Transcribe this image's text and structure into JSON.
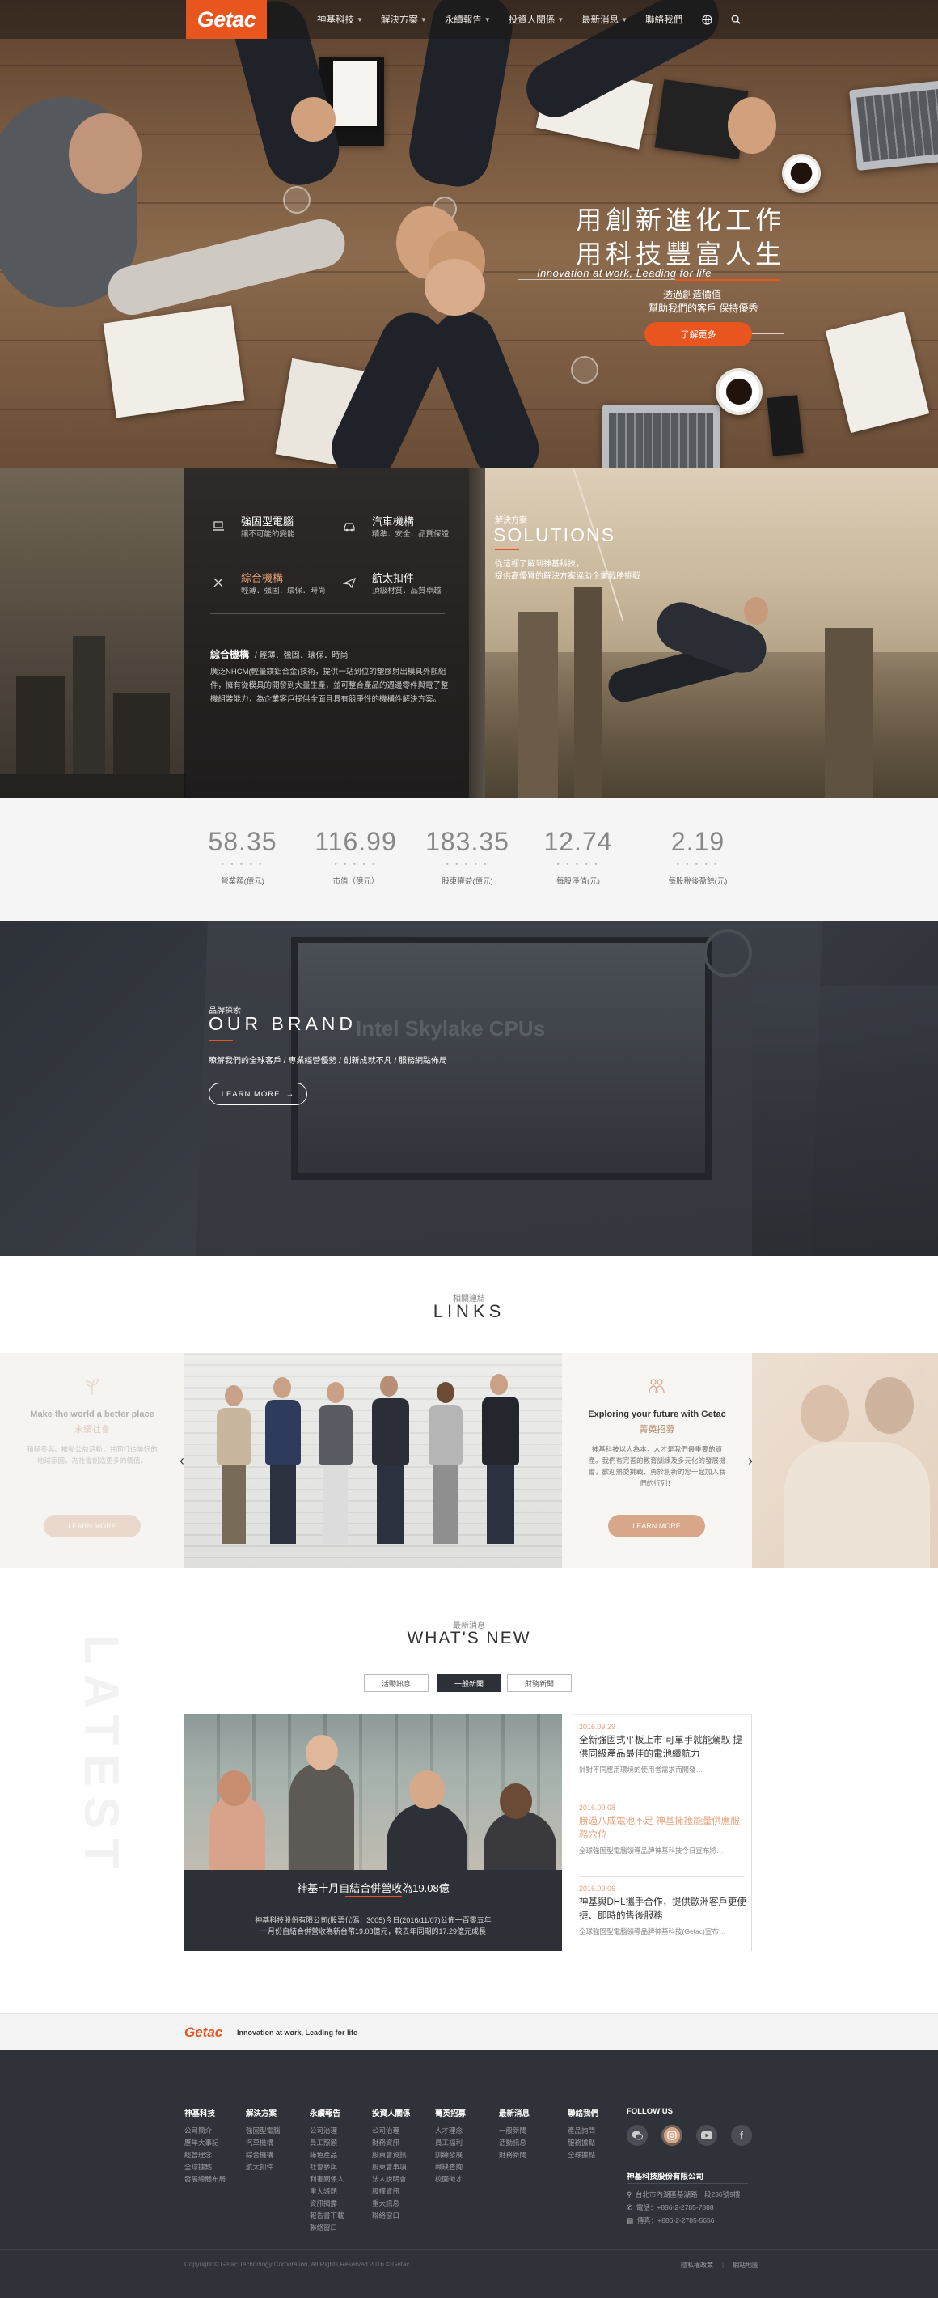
{
  "header": {
    "logo": "Getac",
    "nav": [
      {
        "label": "神基科技"
      },
      {
        "label": "解決方案"
      },
      {
        "label": "永續報告"
      },
      {
        "label": "投資人關係"
      },
      {
        "label": "最新消息"
      },
      {
        "label": "聯絡我們"
      }
    ]
  },
  "hero": {
    "title_line1": "用創新進化工作",
    "title_line2": "用科技豐富人生",
    "subtitle": "Innovation at work, Leading for life",
    "tag_line1": "透過創造價值",
    "tag_line2": "幫助我們的客戶 保持優秀",
    "button": "了解更多"
  },
  "solutions": {
    "items": [
      {
        "title": "強固型電腦",
        "sub": "讓不可能的變能",
        "icon": "laptop-icon"
      },
      {
        "title": "汽車機構",
        "sub": "精準．安全．品質保證",
        "icon": "car-icon"
      },
      {
        "title": "綜合機構",
        "sub": "輕薄．強固．環保．時尚",
        "icon": "tools-icon"
      },
      {
        "title": "航太扣件",
        "sub": "頂級材質．品質卓越",
        "icon": "plane-icon"
      }
    ],
    "desc_title": "綜合機構",
    "desc_sub": "/ 輕薄．強固．環保．時尚",
    "desc_body": "廣泛NHCM(輕量鎂鋁合金)技術，提供一站到位的塑膠射出模具外觀組件，擁有從模具的開發到大量生產，並可整合產品的週邊零件與電子整機組裝能力，為企業客戶提供全面且具有競爭性的機構件解決方案。",
    "small": "解決方案",
    "big": "SOLUTIONS",
    "intro1": "從這裡了解到神基科技，",
    "intro2": "提供高優質的解決方案協助企業戰勝挑戰"
  },
  "stats": [
    {
      "value": "58.35",
      "label": "營業額(億元)"
    },
    {
      "value": "116.99",
      "label": "市值（億元）"
    },
    {
      "value": "183.35",
      "label": "股東權益(億元)"
    },
    {
      "value": "12.74",
      "label": "每股淨值(元)"
    },
    {
      "value": "2.19",
      "label": "每股稅後盈餘(元)"
    }
  ],
  "brand": {
    "small": "品牌探索",
    "title": "OUR BRAND",
    "desc": "瞭解我們的全球客戶 / 專業經營優勢 / 創新成就不凡 / 服務網點佈局",
    "button": "LEARN MORE",
    "screen_text": "Intel Skylake CPUs"
  },
  "links": {
    "small": "相關連結",
    "title": "LINKS",
    "card_left": {
      "title": "Make the world a better place",
      "sub": "永續社會",
      "body": "積極參與、推動公益活動，共同打造美好的地球家園，為社會創造更多的價值。",
      "button": "LEARN MORE"
    },
    "card_right": {
      "title": "Exploring your future with Getac",
      "sub": "菁英招募",
      "body": "神基科技以人為本，人才是我們最重要的資產。我們有完善的教育訓練及多元化的發展機會，歡迎熱愛挑戰、勇於創新的您一起加入我們的行列！",
      "button": "LEARN MORE"
    }
  },
  "whats_new": {
    "small": "最新消息",
    "title": "WHAT'S NEW",
    "watermark": "LATEST",
    "tabs": [
      "活動訊息",
      "一般新聞",
      "財務新聞"
    ],
    "active_tab": 1,
    "featured_title": "神基十月自結合併營收為19.08億",
    "featured_body1": "神基科技股份有限公司(股票代碼：3005)今日(2016/11/07)公佈一百零五年",
    "featured_body2": "十月份自結合併營收為新台幣19.08億元，較去年同期的17.29億元成長",
    "items": [
      {
        "date": "2016.09.29",
        "title": "全新強固式平板上市 可單手就能駕馭 提供同級產品最佳的電池續航力",
        "summary": "針對不同應用環境的使用者需求而開發…"
      },
      {
        "date": "2016.09.08",
        "title": "勝過八成電池不足 神基擁護能量供應服務穴位",
        "summary": "全球強固型電腦領導品牌神基科技今日宣布將…"
      },
      {
        "date": "2016.09.06",
        "title": "神基與DHL攜手合作，提供歐洲客戶更便捷、即時的售後服務",
        "summary": "全球強固型電腦領導品牌神基科技(Getac)宣布…"
      }
    ]
  },
  "footer": {
    "logo": "Getac",
    "tagline": "Innovation at work, Leading for life",
    "columns": [
      {
        "title": "神基科技",
        "items": [
          "公司簡介",
          "歷年大事記",
          "經營理念",
          "全球據點",
          "發展總體布局"
        ]
      },
      {
        "title": "解決方案",
        "items": [
          "強固型電腦",
          "汽車機構",
          "綜合機構",
          "航太扣件"
        ]
      },
      {
        "title": "永續報告",
        "items": [
          "公司治理",
          "員工照顧",
          "綠色產品",
          "社會參與",
          "利害關係人",
          "重大議題",
          "資訊揭露",
          "報告書下載",
          "聯絡窗口"
        ]
      },
      {
        "title": "投資人關係",
        "items": [
          "公司治理",
          "財務資訊",
          "股東會資訊",
          "股東會事項",
          "法人說明會",
          "股權資訊",
          "重大訊息",
          "聯絡窗口"
        ]
      },
      {
        "title": "菁英招募",
        "items": [
          "人才理念",
          "員工福利",
          "訓練發展",
          "職缺查詢",
          "校園徵才"
        ]
      },
      {
        "title": "最新消息",
        "items": [
          "一般新聞",
          "活動訊息",
          "財務新聞"
        ]
      },
      {
        "title": "聯絡我們",
        "items": [
          "產品詢問",
          "服務據點",
          "全球據點"
        ]
      }
    ],
    "follow": "FOLLOW US",
    "company": "神基科技股份有限公司",
    "address": "台北市內湖區基湖路一段236號9樓",
    "phone": "電話：+886-2-2785-7888",
    "fax": "傳真：+886-2-2785-5656",
    "copyright": "Copyright © Getac Technology Corporation, All Rights Reserved 2016 © Getac",
    "bottom_links": "隱私權政策　｜　網站地圖"
  }
}
